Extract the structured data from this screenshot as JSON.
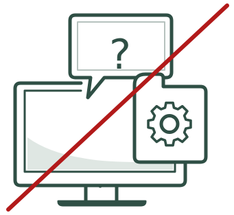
{
  "illustration": {
    "icons": [
      "monitor-icon",
      "speech-bubble-icon",
      "question-mark-icon",
      "gear-icon",
      "prohibition-slash-icon"
    ],
    "question_mark": "?",
    "colors": {
      "line": "#2f4f45",
      "screen_fill": "#dfe7e3",
      "slash": "#b21a1a",
      "background": "#ffffff"
    }
  }
}
